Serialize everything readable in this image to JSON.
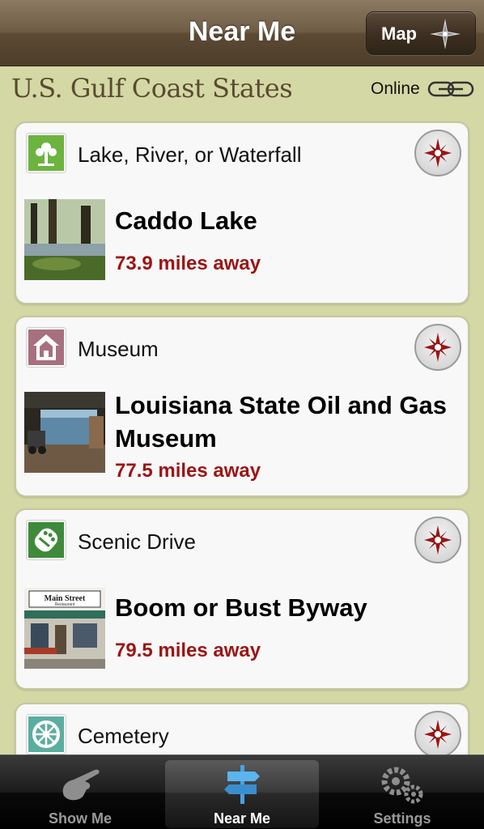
{
  "nav": {
    "title": "Near Me",
    "map_label": "Map"
  },
  "header": {
    "region": "U.S. Gulf Coast States",
    "status": "Online"
  },
  "places": [
    {
      "category": "Lake, River, or Waterfall",
      "category_icon": "tree-icon",
      "name": "Caddo Lake",
      "distance": "73.9 miles away"
    },
    {
      "category": "Museum",
      "category_icon": "house-icon",
      "name": "Louisiana State Oil and Gas Museum",
      "distance": "77.5 miles away"
    },
    {
      "category": "Scenic Drive",
      "category_icon": "footprint-icon",
      "name": "Boom or Bust Byway",
      "distance": "79.5 miles away"
    },
    {
      "category": "Cemetery",
      "category_icon": "wreath-icon",
      "name": "",
      "distance": ""
    }
  ],
  "thumb_text": {
    "sign": "Main Street",
    "sign_sub": "Restaurant"
  },
  "tabs": [
    {
      "label": "Show Me",
      "icon": "pointing-hand-icon",
      "active": false
    },
    {
      "label": "Near Me",
      "icon": "signpost-icon",
      "active": true
    },
    {
      "label": "Settings",
      "icon": "gears-icon",
      "active": false
    }
  ],
  "colors": {
    "accent_red": "#9c1414",
    "background": "#d4d8a4",
    "nav_brown": "#6e5c45"
  }
}
